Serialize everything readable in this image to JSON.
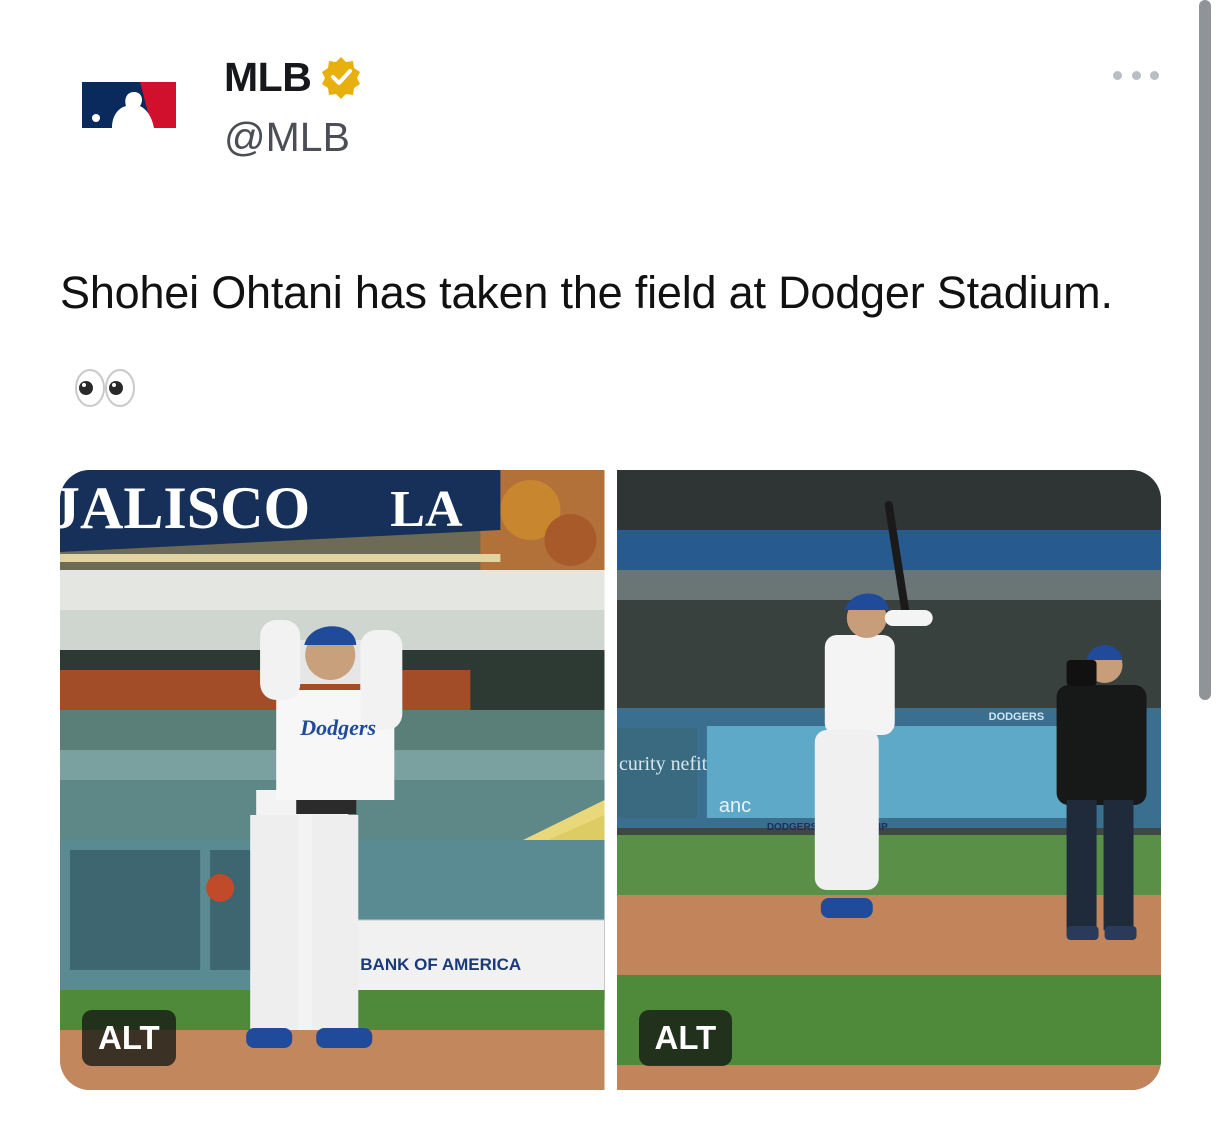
{
  "tweet": {
    "author": {
      "display_name": "MLB",
      "handle": "@MLB",
      "verified_icon": "verified-badge-gold"
    },
    "more_icon": "more-horizontal-icon",
    "text": "Shohei Ohtani has taken the field at Dodger Stadium.",
    "emoji": "eyes-emoji",
    "media": [
      {
        "alt_label": "ALT",
        "sign_text": "JALISCO",
        "banner_text": "BANK OF AMERICA",
        "jersey_text": "Dodgers"
      },
      {
        "alt_label": "ALT",
        "board_left_text": "curity nefit",
        "board_right_text": "DODGERS",
        "board_bottom_text": "DODGERS MEMBERSHIP",
        "board_logo_text": "anc"
      }
    ]
  },
  "colors": {
    "verified_gold": "#e8b00f",
    "mlb_blue": "#0a2a5e",
    "mlb_red": "#d0102c",
    "dodger_blue": "#1c4f9c"
  }
}
